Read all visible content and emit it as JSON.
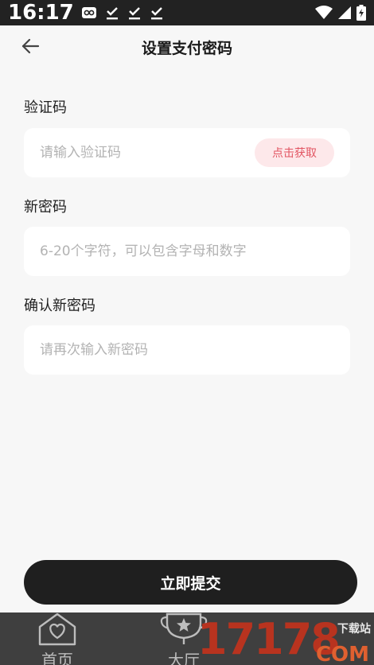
{
  "status_bar": {
    "time": "16:17"
  },
  "header": {
    "title": "设置支付密码"
  },
  "form": {
    "code": {
      "label": "验证码",
      "placeholder": "请输入验证码",
      "get_code_label": "点击获取"
    },
    "new_password": {
      "label": "新密码",
      "placeholder": "6-20个字符，可以包含字母和数字"
    },
    "confirm_password": {
      "label": "确认新密码",
      "placeholder": "请再次输入新密码"
    }
  },
  "submit_label": "立即提交",
  "tab_bar": {
    "items": [
      {
        "label": "首页",
        "icon": "home-heart-icon"
      },
      {
        "label": "大厅",
        "icon": "trophy-icon"
      }
    ]
  },
  "watermark": {
    "number": "17178",
    "site": "下载站",
    "domain": "COM"
  },
  "colors": {
    "background": "#f7f7f7",
    "accent_pink_bg": "#fde8ea",
    "accent_pink_text": "#e25562",
    "dark": "#1f1f1f"
  }
}
